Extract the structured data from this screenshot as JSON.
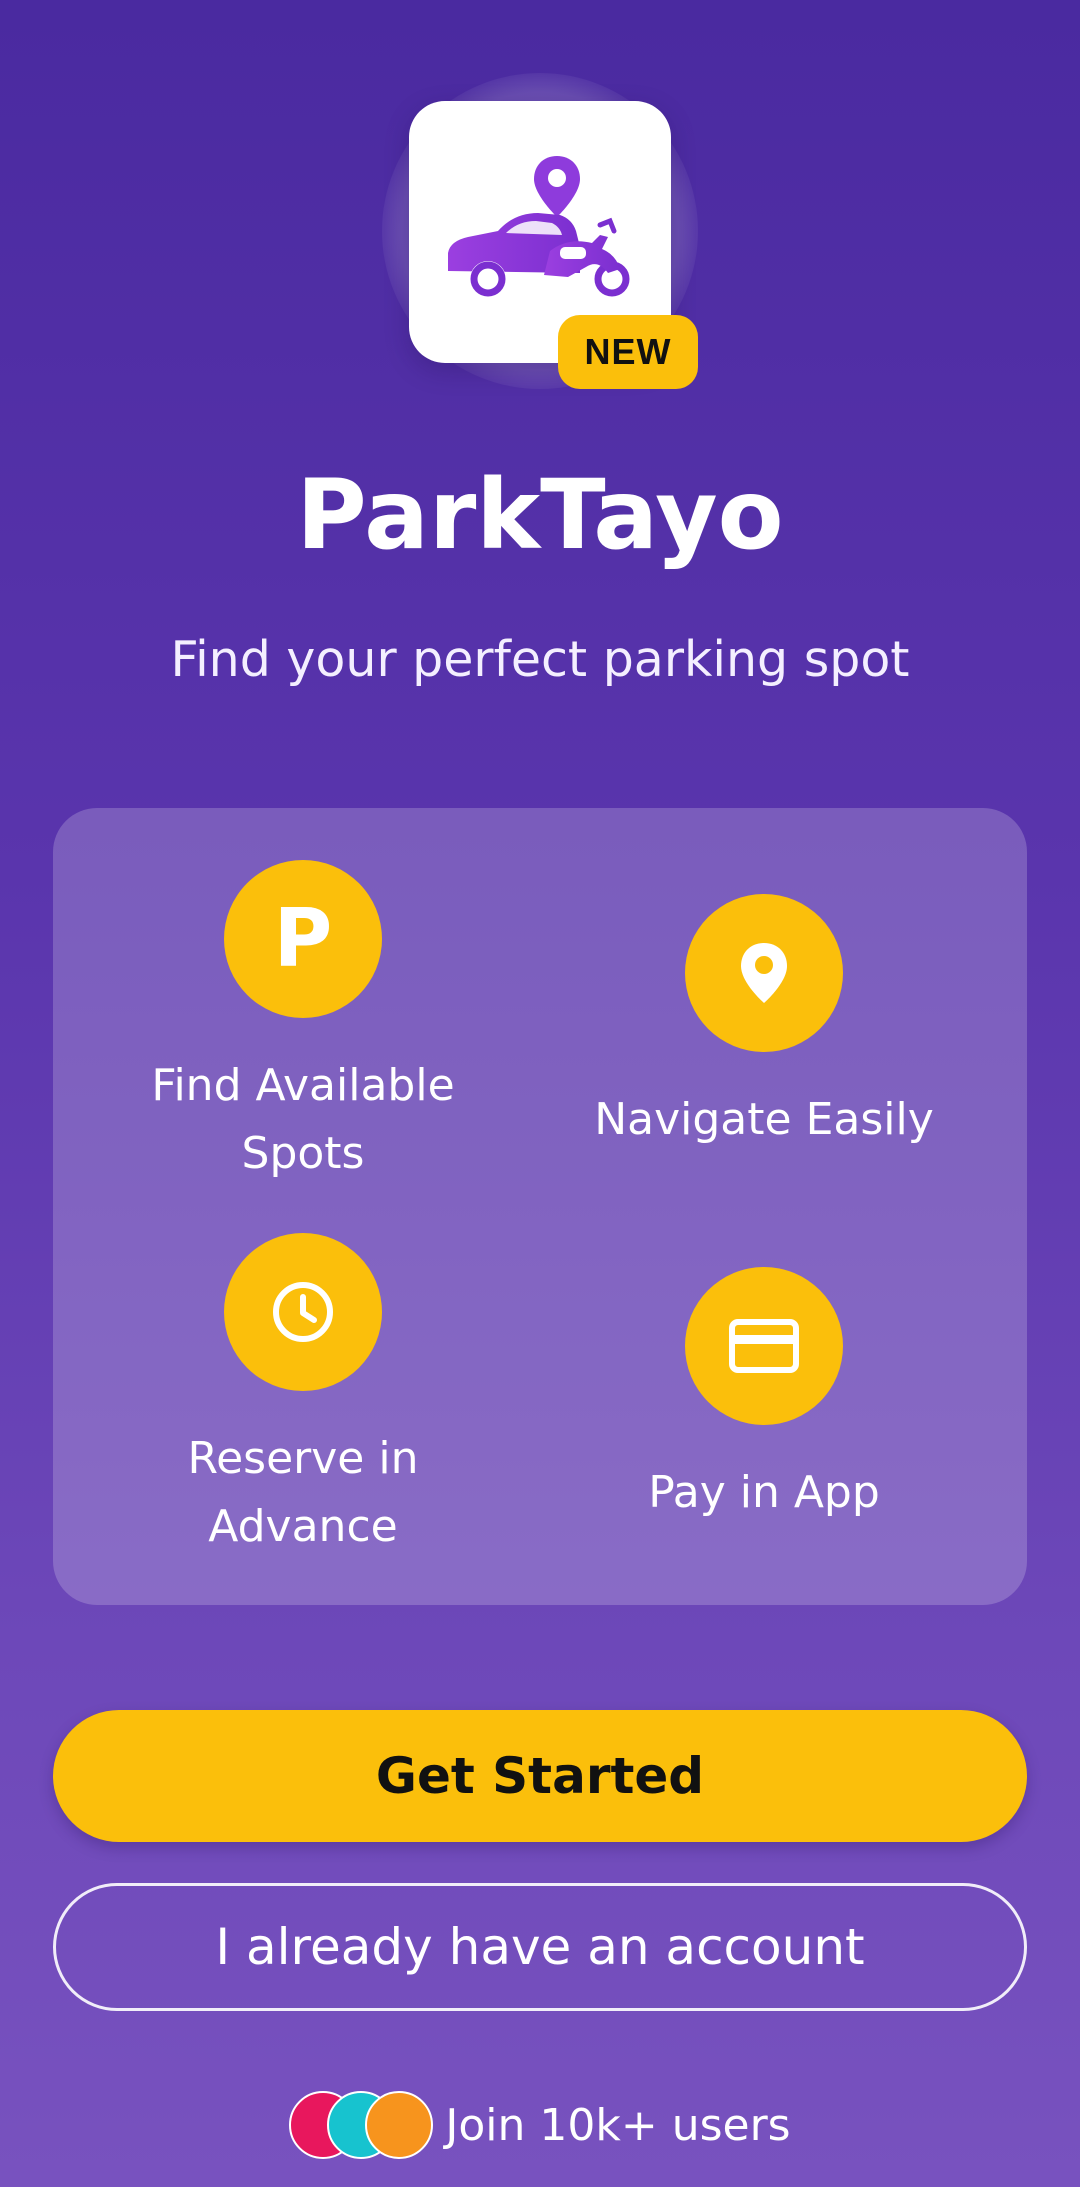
{
  "app": {
    "name": "ParkTayo",
    "tagline": "Find your perfect parking spot",
    "badge": "NEW",
    "logo_icon": "car-motorcycle-location-icon"
  },
  "features": [
    {
      "label": "Find Available Spots",
      "icon": "parking-icon",
      "icon_text": "P"
    },
    {
      "label": "Navigate Easily",
      "icon": "location-pin-icon"
    },
    {
      "label": "Reserve in Advance",
      "icon": "clock-icon"
    },
    {
      "label": "Pay in App",
      "icon": "credit-card-icon"
    }
  ],
  "actions": {
    "primary_label": "Get Started",
    "secondary_label": "I already have an account"
  },
  "social_proof": {
    "text": "Join 10k+ users",
    "avatar_colors": [
      "#e8175d",
      "#17c3cf",
      "#f7941d"
    ]
  },
  "colors": {
    "accent": "#fbbf0b",
    "background_top": "#4a2aa0",
    "background_bottom": "#7852bf"
  }
}
